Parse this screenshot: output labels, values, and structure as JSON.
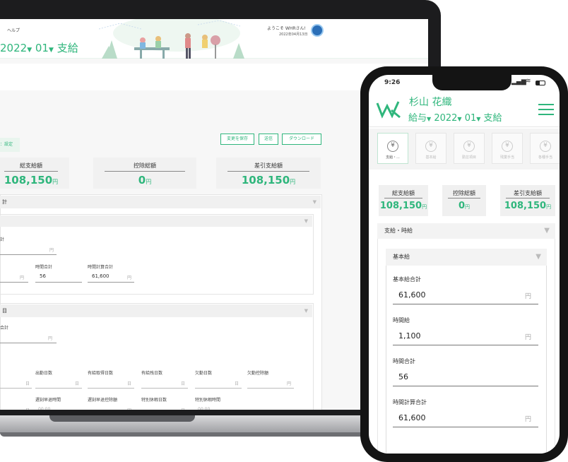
{
  "laptop": {
    "menu_help": "ヘルプ",
    "welcome": "ようこそ WHRさん!",
    "date": "2022年04月13日",
    "period": {
      "year": "2022",
      "month": "01",
      "type": "支給"
    },
    "buttons": {
      "save": "変更を保存",
      "send": "送信",
      "download": "ダウンロード"
    },
    "status": "：設定",
    "summary": [
      {
        "label": "総支給額",
        "value": "108,150",
        "unit": "円"
      },
      {
        "label": "控除総額",
        "value": "0",
        "unit": "円"
      },
      {
        "label": "差引支給額",
        "value": "108,150",
        "unit": "円"
      }
    ],
    "section_top": "計",
    "basic_label": "計",
    "basic_unit": "円",
    "row2": {
      "unit1": "円",
      "hours_label": "時間合計",
      "hours_value": "56",
      "calc_label": "時間計算合計",
      "calc_value": "61,600",
      "calc_unit": "円"
    },
    "section2": "目",
    "s2_label": "合計",
    "s2_unit": "円",
    "days_row": [
      {
        "label": "日数",
        "unit": "日"
      },
      {
        "label": "出勤日数",
        "unit": "日"
      },
      {
        "label": "有給取得日数",
        "unit": "日"
      },
      {
        "label": "有給残日数",
        "unit": "日"
      },
      {
        "label": "欠勤日数",
        "unit": "日"
      },
      {
        "label": "欠勤控除額",
        "unit": "円"
      }
    ],
    "late_row": [
      {
        "label": "日数",
        "value": "日"
      },
      {
        "label": "遅刻早退時間",
        "value": "00:00"
      },
      {
        "label": "遅刻早退控除額",
        "value": "円"
      },
      {
        "label": "特別休暇日数",
        "value": "日"
      },
      {
        "label": "特別休暇時間",
        "value": "00:00"
      }
    ]
  },
  "phone": {
    "time": "9:26",
    "user_name": "杉山 花織",
    "category": "給与",
    "year": "2022",
    "month": "01",
    "type": "支給",
    "tabs": [
      "支給・...",
      "基本給",
      "勤怠項目",
      "残業手当",
      "各種手当"
    ],
    "summary": [
      {
        "label": "総支給額",
        "value": "108,150",
        "unit": "円"
      },
      {
        "label": "控除総額",
        "value": "0",
        "unit": "円"
      },
      {
        "label": "差引支給額",
        "value": "108,150",
        "unit": "円"
      }
    ],
    "section": "支給・時給",
    "sub_section": "基本給",
    "fields": [
      {
        "label": "基本給合計",
        "value": "61,600",
        "unit": "円"
      },
      {
        "label": "時間給",
        "value": "1,100",
        "unit": "円"
      },
      {
        "label": "時間合計",
        "value": "56",
        "unit": ""
      },
      {
        "label": "時間計算合計",
        "value": "61,600",
        "unit": "円"
      }
    ]
  },
  "colors": {
    "accent": "#2fb67c",
    "device": "#1c1c1e"
  }
}
